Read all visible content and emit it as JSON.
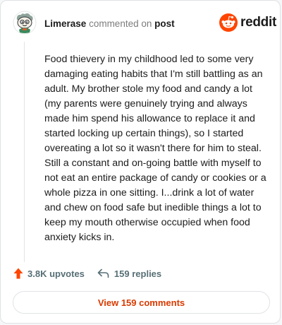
{
  "header": {
    "username": "Limerase",
    "action": "commented on",
    "target": "post",
    "logo_text": "reddit"
  },
  "comment": {
    "body": "Food thievery in my childhood led to some very damaging eating habits that I'm still battling as an adult. My brother stole my food and candy a lot (my parents were genuinely trying and always made him spend his allowance to replace it and started locking up certain things), so I started overeating a lot so it wasn't there for him to steal. Still a constant and on-going battle with myself to not eat an entire package of candy or cookies or a whole pizza in one sitting. I...drink a lot of water and chew on food safe but inedible things a lot to keep my mouth otherwise occupied when food anxiety kicks in."
  },
  "actions": {
    "upvotes_label": "3.8K upvotes",
    "upvote_icon": "upvote-arrow-icon",
    "replies_label": "159 replies",
    "reply_icon": "reply-arrow-icon"
  },
  "footer": {
    "view_button_label": "View 159 comments"
  },
  "colors": {
    "brand": "#ff4500",
    "link": "#d93a00",
    "meta": "#576f76"
  }
}
